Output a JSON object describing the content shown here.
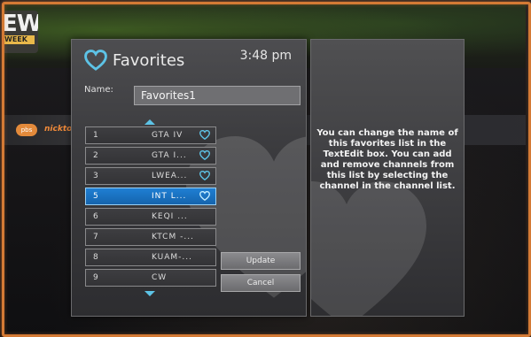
{
  "background": {
    "corner_logo_big": "EW",
    "corner_logo_small": "WEEK",
    "strip_logo_left": "pbs",
    "strip_logo_right": "nicktoons"
  },
  "dialog": {
    "title": "Favorites",
    "clock": "3:48 pm",
    "name_label": "Name:",
    "name_value": "Favorites1",
    "channels": [
      {
        "num": "1",
        "name": "GTA IV",
        "favorite": true
      },
      {
        "num": "2",
        "name": "GTA I...",
        "favorite": true
      },
      {
        "num": "3",
        "name": "LWEA...",
        "favorite": true
      },
      {
        "num": "5",
        "name": "INT L...",
        "favorite": true,
        "selected": true
      },
      {
        "num": "6",
        "name": "KEQI ...",
        "favorite": false
      },
      {
        "num": "7",
        "name": "KTCM -...",
        "favorite": false
      },
      {
        "num": "8",
        "name": "KUAM-...",
        "favorite": false
      },
      {
        "num": "9",
        "name": "CW",
        "favorite": false
      }
    ],
    "update_label": "Update",
    "cancel_label": "Cancel"
  },
  "help": {
    "text": "You can change the name of this favorites list in the TextEdit box. You can add and remove channels from this list by selecting the channel in the channel list."
  },
  "colors": {
    "accent_blue": "#5dc3e6",
    "selected_row": "#1f7fd3",
    "border_glow": "#d47a35"
  }
}
